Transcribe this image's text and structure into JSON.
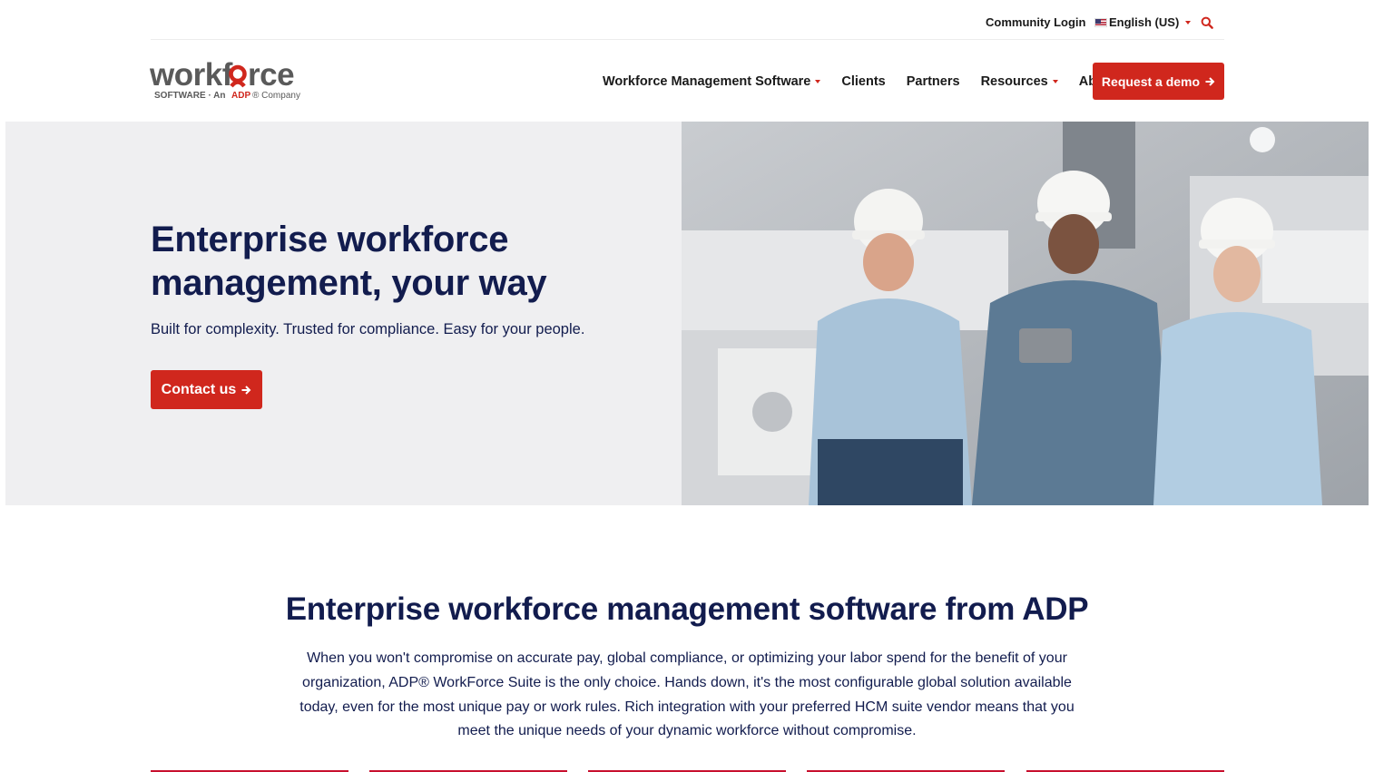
{
  "utility": {
    "community_login": "Community Login",
    "language": "English (US)"
  },
  "logo": {
    "wordmark": "workforce",
    "tagline": "SOFTWARE · An ADP® Company"
  },
  "nav": {
    "items": [
      {
        "label": "Workforce Management Software",
        "has_dropdown": true
      },
      {
        "label": "Clients",
        "has_dropdown": false
      },
      {
        "label": "Partners",
        "has_dropdown": false
      },
      {
        "label": "Resources",
        "has_dropdown": true
      },
      {
        "label": "About",
        "has_dropdown": false
      }
    ],
    "cta": "Request a demo"
  },
  "hero": {
    "title": "Enterprise workforce management, your way",
    "subtitle": "Built for complexity. Trusted for compliance. Easy for your people.",
    "cta": "Contact us"
  },
  "section": {
    "title": "Enterprise workforce management software from ADP",
    "body": "When you won't compromise on accurate pay, global compliance, or optimizing your labor spend for the benefit of your organization, ADP® WorkForce Suite is the only choice. Hands down, it's the most configurable global solution available today, even for the most unique pay or work rules. Rich integration with your preferred HCM suite vendor means that you meet the unique needs of your dynamic workforce without compromise."
  },
  "colors": {
    "brand_red": "#d0271d",
    "navy": "#121c4e",
    "hero_bg": "#efeff1"
  },
  "icons": {
    "search": "search-icon",
    "arrow": "arrow-right-icon",
    "dropdown": "caret-down-icon"
  }
}
